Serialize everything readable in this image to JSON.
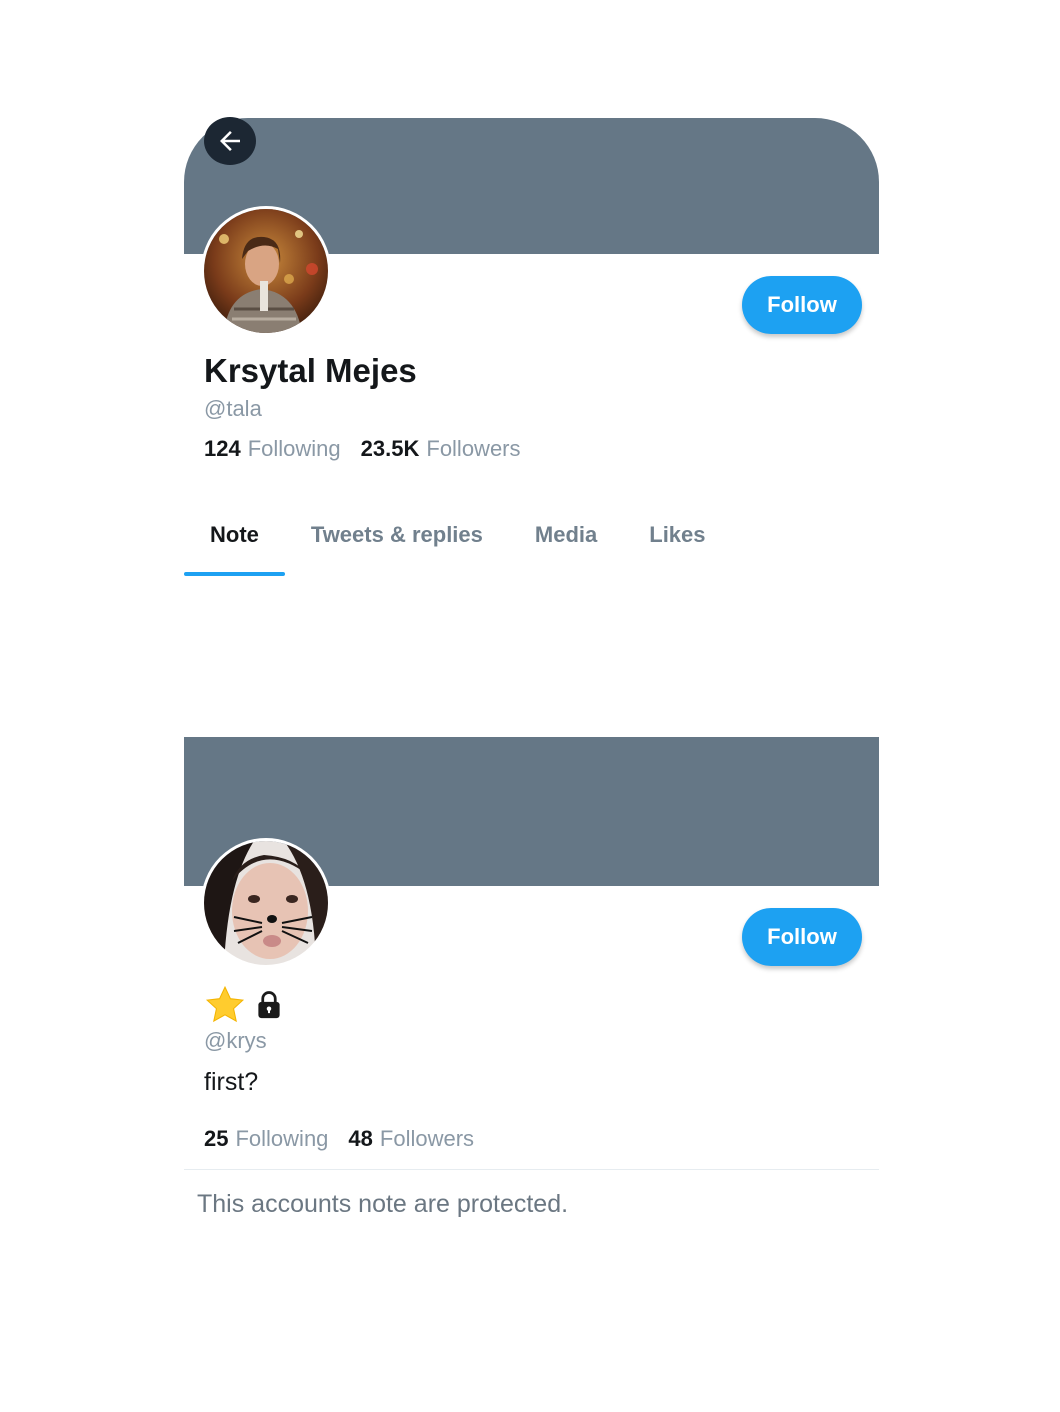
{
  "profile_main": {
    "display_name": "Krsytal Mejes",
    "handle": "@tala",
    "follow_label": "Follow",
    "following_count": "124",
    "following_label": "Following",
    "followers_count": "23.5K",
    "followers_label": "Followers",
    "icons": {
      "back": "arrow-left-icon"
    }
  },
  "tabs": [
    {
      "label": "Note",
      "active": true
    },
    {
      "label": "Tweets & replies",
      "active": false
    },
    {
      "label": "Media",
      "active": false
    },
    {
      "label": "Likes",
      "active": false
    }
  ],
  "profile_secondary": {
    "handle": "@krys",
    "bio": "first?",
    "follow_label": "Follow",
    "following_count": "25",
    "following_label": "Following",
    "followers_count": "48",
    "followers_label": "Followers",
    "badges": [
      "star-icon",
      "lock-icon"
    ],
    "protected_message": "This accounts note are protected."
  },
  "colors": {
    "banner": "#657786",
    "accent": "#1da1f2",
    "back_button": "#1c2733",
    "muted_text": "#8a98a5"
  }
}
